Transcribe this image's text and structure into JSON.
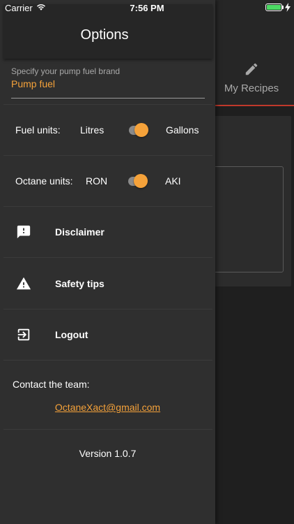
{
  "status_bar": {
    "carrier": "Carrier",
    "time": "7:56 PM",
    "battery_color": "#4cd964"
  },
  "background": {
    "tab_label": "My Recipes",
    "tab_icon": "pencil-icon",
    "tab_underline_color": "#c0392b"
  },
  "drawer": {
    "title": "Options",
    "pump_fuel": {
      "label": "Specify your pump fuel brand",
      "value": "Pump fuel"
    },
    "fuel_units": {
      "label": "Fuel units:",
      "left_option": "Litres",
      "right_option": "Gallons",
      "selected": "Gallons"
    },
    "octane_units": {
      "label": "Octane units:",
      "left_option": "RON",
      "right_option": "AKI",
      "selected": "AKI"
    },
    "menu": [
      {
        "label": "Disclaimer",
        "icon": "feedback-alert-icon"
      },
      {
        "label": "Safety tips",
        "icon": "warning-icon"
      },
      {
        "label": "Logout",
        "icon": "exit-icon"
      }
    ],
    "contact": {
      "label": "Contact the team:",
      "email": "OctaneXact@gmail.com"
    },
    "version": "Version 1.0.7",
    "accent_color": "#f5a23a"
  }
}
